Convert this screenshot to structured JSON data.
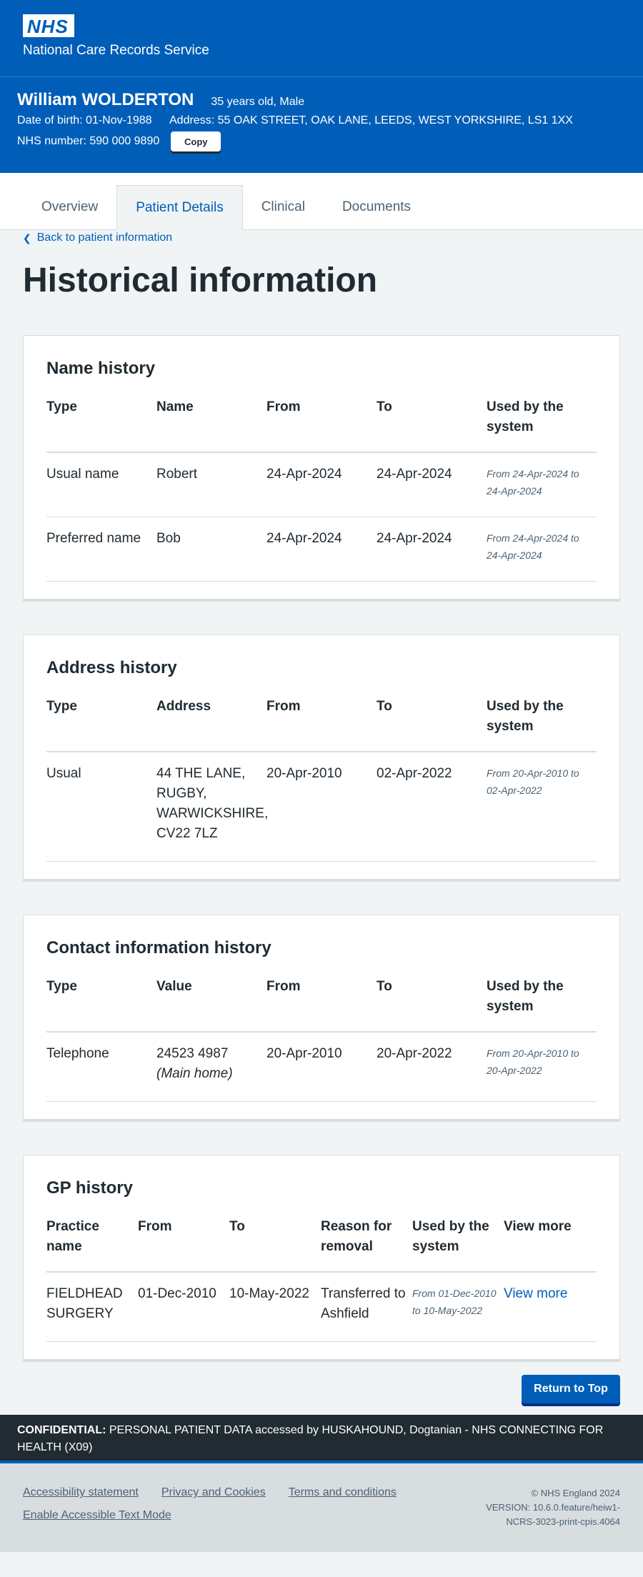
{
  "header": {
    "logo": "NHS",
    "service_name": "National Care Records Service"
  },
  "banner": {
    "patient_name": "William WOLDERTON",
    "age_sex": "35 years old, Male",
    "dob": "Date of birth: 01-Nov-1988",
    "address": "Address: 55 OAK STREET, OAK LANE, LEEDS, WEST YORKSHIRE, LS1 1XX",
    "nhs_number": "NHS number: 590 000 9890",
    "copy_label": "Copy"
  },
  "tabs": [
    {
      "label": "Overview"
    },
    {
      "label": "Patient Details"
    },
    {
      "label": "Clinical"
    },
    {
      "label": "Documents"
    }
  ],
  "back_link": "Back to patient information",
  "page_title": "Historical information",
  "name_history": {
    "title": "Name history",
    "headers": [
      "Type",
      "Name",
      "From",
      "To",
      "Used by the system"
    ],
    "rows": [
      {
        "type": "Usual name",
        "name": "Robert",
        "from": "24-Apr-2024",
        "to": "24-Apr-2024",
        "used": "From 24-Apr-2024 to 24-Apr-2024"
      },
      {
        "type": "Preferred name",
        "name": "Bob",
        "from": "24-Apr-2024",
        "to": "24-Apr-2024",
        "used": "From 24-Apr-2024 to 24-Apr-2024"
      }
    ]
  },
  "address_history": {
    "title": "Address history",
    "headers": [
      "Type",
      "Address",
      "From",
      "To",
      "Used by the system"
    ],
    "rows": [
      {
        "type": "Usual",
        "address": "44 THE LANE, RUGBY, WARWICKSHIRE, CV22 7LZ",
        "from": "20-Apr-2010",
        "to": "02-Apr-2022",
        "used": "From 20-Apr-2010 to 02-Apr-2022"
      }
    ]
  },
  "contact_history": {
    "title": "Contact information history",
    "headers": [
      "Type",
      "Value",
      "From",
      "To",
      "Used by the system"
    ],
    "rows": [
      {
        "type": "Telephone",
        "value": "24523 4987",
        "value_note": "(Main home)",
        "from": "20-Apr-2010",
        "to": "20-Apr-2022",
        "used": "From 20-Apr-2010 to 20-Apr-2022"
      }
    ]
  },
  "gp_history": {
    "title": "GP history",
    "headers": [
      "Practice name",
      "From",
      "To",
      "Reason for removal",
      "Used by the system",
      "View more"
    ],
    "rows": [
      {
        "practice": "FIELDHEAD SURGERY",
        "from": "01-Dec-2010",
        "to": "10-May-2022",
        "reason": "Transferred to Ashfield",
        "used": "From 01-Dec-2010 to 10-May-2022",
        "view_more": "View more"
      }
    ]
  },
  "return_top_label": "Return to Top",
  "confidential": {
    "label": "CONFIDENTIAL:",
    "text": " PERSONAL PATIENT DATA accessed by HUSKAHOUND, Dogtanian - NHS CONNECTING FOR HEALTH (X09)"
  },
  "footer": {
    "links": [
      "Accessibility statement",
      "Privacy and Cookies",
      "Terms and conditions",
      "Enable Accessible Text Mode"
    ],
    "copyright": "© NHS England 2024",
    "version": "VERSION: 10.6.0.feature/heiw1-",
    "version2": "NCRS-3023-print-cpis.4064"
  },
  "colors": {
    "nhs_blue": "#005eb8",
    "dark": "#212b32",
    "background": "#f0f4f5",
    "border": "#d8dde0"
  }
}
